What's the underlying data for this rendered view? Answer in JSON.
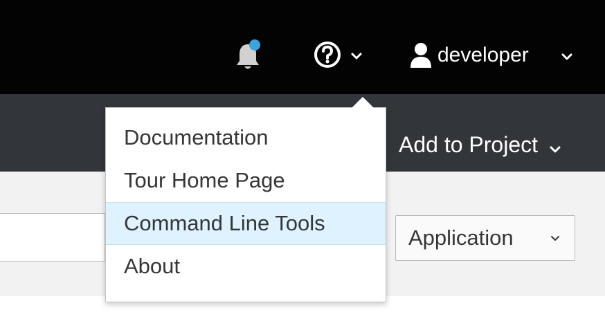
{
  "masthead": {
    "background": "#030303",
    "notification": {
      "icon": "bell-icon",
      "badge_color": "#39a5dc"
    },
    "help": {
      "icon": "question-circle-icon"
    },
    "user": {
      "icon": "user-icon",
      "label": "developer"
    }
  },
  "toolbar": {
    "background": "#32363a",
    "add_to_project_label": "Add to Project"
  },
  "content": {
    "application_select": {
      "label": "Application"
    }
  },
  "help_menu": {
    "items": [
      {
        "label": "Documentation",
        "active": false
      },
      {
        "label": "Tour Home Page",
        "active": false
      },
      {
        "label": "Command Line Tools",
        "active": true
      },
      {
        "label": "About",
        "active": false
      }
    ]
  }
}
